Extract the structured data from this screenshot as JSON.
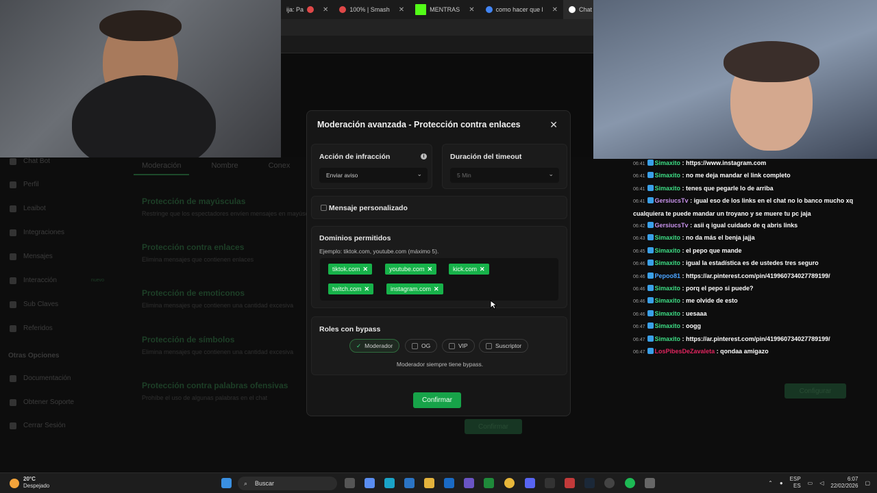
{
  "browser": {
    "tabs": [
      {
        "label": "ija: Pa",
        "color": "#e04848"
      },
      {
        "label": "100% | Smash",
        "color": "#e04848"
      },
      {
        "label": "MENTRAS",
        "color": "#53fc18"
      },
      {
        "label": "como hacer que l",
        "color": "#4285f4"
      },
      {
        "label": "Chat Bot | El",
        "color": "#ffffff"
      }
    ]
  },
  "dashboard": {
    "sidebar": [
      {
        "label": "Chat Bot"
      },
      {
        "label": "Perfil"
      },
      {
        "label": "Leaibot"
      },
      {
        "label": "Integraciones"
      },
      {
        "label": "Mensajes"
      },
      {
        "label": "Interacción",
        "badge": "nuevo"
      },
      {
        "label": "Sub Claves"
      },
      {
        "label": "Referidos"
      }
    ],
    "sidebar_section": "Otras Opciones",
    "sidebar_extra": [
      {
        "label": "Documentación"
      },
      {
        "label": "Obtener Soporte"
      },
      {
        "label": "Cerrar Sesión"
      }
    ],
    "tabs": [
      "Moderación",
      "Nombre",
      "Conex"
    ],
    "protections": [
      {
        "title": "Protección de mayúsculas",
        "desc": "Restringe que los espectadores envíen mensajes en mayúsculas"
      },
      {
        "title": "Protección contra enlaces",
        "desc": "Elimina mensajes que contienen enlaces"
      },
      {
        "title": "Protección de emoticonos",
        "desc": "Elimina mensajes que contienen una cantidad excesiva"
      },
      {
        "title": "Protección de símbolos",
        "desc": "Elimina mensajes que contienen una cantidad excesiva"
      },
      {
        "title": "Protección contra palabras ofensivas",
        "desc": "Prohíbe el uso de algunas palabras en el chat"
      }
    ],
    "behind_confirm": "Confirmar",
    "configure": "Configurar"
  },
  "chat": [
    {
      "time": "06:41",
      "user": "Simaxito",
      "color": "#3ddc84",
      "text": "https://www.instagram.com"
    },
    {
      "time": "06:41",
      "user": "Simaxito",
      "color": "#3ddc84",
      "text": "no me deja mandar el link completo"
    },
    {
      "time": "06:41",
      "user": "Simaxito",
      "color": "#3ddc84",
      "text": "tenes que pegarle lo de arriba"
    },
    {
      "time": "06:41",
      "user": "GersiucsTv",
      "color": "#c792ea",
      "text": "igual eso de los links en el chat no lo banco mucho xq cualquiera te puede mandar un troyano y se muere tu pc jaja"
    },
    {
      "time": "06:42",
      "user": "GersiucsTv",
      "color": "#c792ea",
      "text": "asii q igual cuidado de q abris links"
    },
    {
      "time": "06:43",
      "user": "Simaxito",
      "color": "#3ddc84",
      "text": "no da más el benja jajja"
    },
    {
      "time": "06:45",
      "user": "Simaxito",
      "color": "#3ddc84",
      "text": "el pepo que mande"
    },
    {
      "time": "06:46",
      "user": "Simaxito",
      "color": "#3ddc84",
      "text": "igual la estadística es de ustedes tres seguro"
    },
    {
      "time": "06:46",
      "user": "Pepoo81",
      "color": "#4aa3ff",
      "text": "https://ar.pinterest.com/pin/419960734027789199/"
    },
    {
      "time": "06:46",
      "user": "Simaxito",
      "color": "#3ddc84",
      "text": "porq el pepo si puede?"
    },
    {
      "time": "06:46",
      "user": "Simaxito",
      "color": "#3ddc84",
      "text": "me olvide de esto"
    },
    {
      "time": "06:46",
      "user": "Simaxito",
      "color": "#3ddc84",
      "text": "uesaaa"
    },
    {
      "time": "06:47",
      "user": "Simaxito",
      "color": "#3ddc84",
      "text": "oogg"
    },
    {
      "time": "06:47",
      "user": "Simaxito",
      "color": "#3ddc84",
      "text": "https://ar.pinterest.com/pin/419960734027789199/"
    },
    {
      "time": "06:47",
      "user": "LosPibesDeZavaleta",
      "color": "#e0245e",
      "text": "qondaa amigazo"
    }
  ],
  "modal": {
    "title": "Moderación avanzada - Protección contra enlaces",
    "infraction_label": "Acción de infracción",
    "infraction_value": "Enviar aviso",
    "timeout_label": "Duración del timeout",
    "timeout_value": "5 Min",
    "custom_message": "Mensaje personalizado",
    "domains_label": "Dominios permitidos",
    "domains_hint": "Ejemplo: tiktok.com, youtube.com (máximo 5).",
    "domains": [
      "tiktok.com",
      "youtube.com",
      "kick.com",
      "twitch.com",
      "instagram.com"
    ],
    "roles_label": "Roles con bypass",
    "roles": [
      {
        "label": "Moderador",
        "checked": true
      },
      {
        "label": "OG",
        "checked": false
      },
      {
        "label": "VIP",
        "checked": false
      },
      {
        "label": "Suscriptor",
        "checked": false
      }
    ],
    "roles_note": "Moderador siempre tiene bypass.",
    "confirm": "Confirmar"
  },
  "taskbar": {
    "temp": "20°C",
    "weather": "Despejado",
    "search": "Buscar",
    "lang1": "ESP",
    "lang2": "ES",
    "time": "6:07",
    "date": "22/02/2026"
  }
}
